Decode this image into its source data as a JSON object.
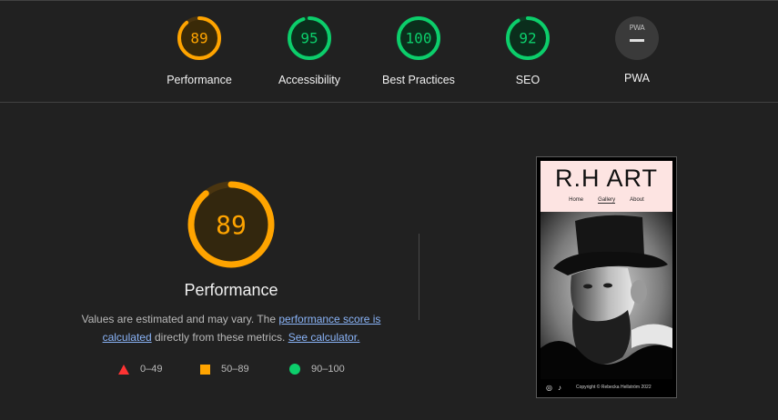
{
  "scores": [
    {
      "label": "Performance",
      "value": "89",
      "fraction": 0.89,
      "color": "#ffa400"
    },
    {
      "label": "Accessibility",
      "value": "95",
      "fraction": 0.95,
      "color": "#0cce6b"
    },
    {
      "label": "Best Practices",
      "value": "100",
      "fraction": 1.0,
      "color": "#0cce6b"
    },
    {
      "label": "SEO",
      "value": "92",
      "fraction": 0.92,
      "color": "#0cce6b"
    },
    {
      "label": "PWA",
      "badge": "PWA",
      "icon": "pwa-badge-icon"
    }
  ],
  "main": {
    "score": "89",
    "fraction": 0.89,
    "color": "#ffa400",
    "title": "Performance",
    "desc_prefix": "Values are estimated and may vary. The ",
    "desc_link1": "performance score is calculated",
    "desc_middle": " directly from these metrics. ",
    "desc_link2": "See calculator."
  },
  "legend": [
    {
      "range": "0–49",
      "shape": "triangle",
      "color": "#ff3333"
    },
    {
      "range": "50–89",
      "shape": "square",
      "color": "#ffa400"
    },
    {
      "range": "90–100",
      "shape": "circle",
      "color": "#0cce6b"
    }
  ],
  "screenshot": {
    "logo": "R.H  ART",
    "nav": [
      "Home",
      "Gallery",
      "About"
    ],
    "footer_copy": "Copyright © Rebecka Hellström 2022",
    "footer_icons": [
      "instagram-icon",
      "tiktok-icon"
    ]
  }
}
